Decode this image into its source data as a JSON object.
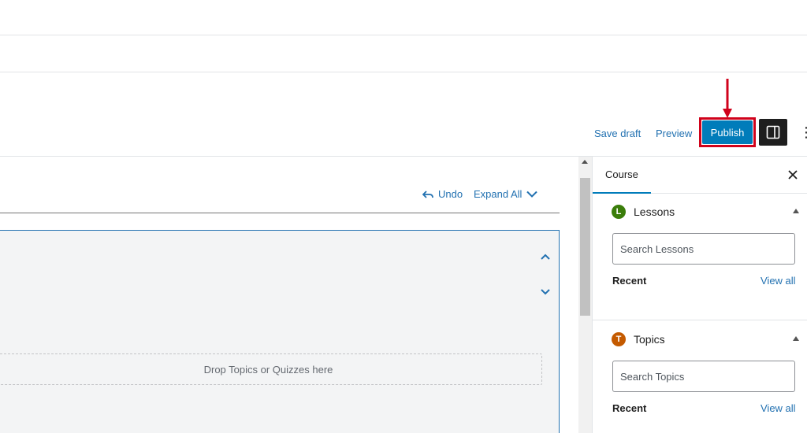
{
  "toolbar": {
    "save_draft": "Save draft",
    "preview": "Preview",
    "publish": "Publish",
    "highlight_color": "#d0021b",
    "publish_color": "#007cba"
  },
  "builder": {
    "undo": "Undo",
    "expand_all": "Expand All",
    "dropzone": "Drop Topics or Quizzes here"
  },
  "sidebar": {
    "tab": "Course",
    "panels": [
      {
        "badge": "L",
        "badge_color": "#3a7d0a",
        "title": "Lessons",
        "search_placeholder": "Search Lessons",
        "recent": "Recent",
        "view_all": "View all"
      },
      {
        "badge": "T",
        "badge_color": "#c45a00",
        "title": "Topics",
        "search_placeholder": "Search Topics",
        "recent": "Recent",
        "view_all": "View all"
      }
    ]
  }
}
